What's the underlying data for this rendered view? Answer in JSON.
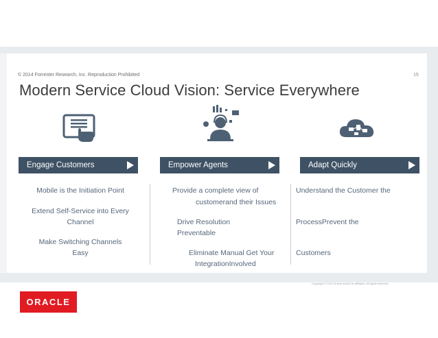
{
  "header": {
    "copyright": "© 2014 Forrester Research, Inc. Reproduction Prohibited",
    "page_number": "15",
    "title": "Modern Service Cloud Vision: Service Everywhere"
  },
  "columns": [
    {
      "heading": "Engage Customers",
      "icon": "tablet-touch-icon",
      "items": [
        "Mobile is the Initiation Point",
        "Extend Self-Service into Every",
        "Channel",
        "Make Switching Channels",
        "Easy"
      ]
    },
    {
      "heading": "Empower Agents",
      "icon": "agent-headset-icon",
      "items": [
        "Provide a complete view of",
        "customerand their Issues",
        "Drive Resolution",
        "Preventable",
        "Eliminate Manual Get Your",
        "IntegrationInvolved"
      ]
    },
    {
      "heading": "Adapt Quickly",
      "icon": "cloud-network-icon",
      "items": [
        "Understand the Customer the",
        "ProcessPrevent the",
        "Customers"
      ]
    }
  ],
  "footer": {
    "copyright": "Copyright © 2014 Oracle and/or its affiliates. All rights reserved.",
    "logo_text": "ORACLE"
  },
  "colors": {
    "bar": "#3f5265",
    "item_text": "#55667a",
    "icon": "#4e6174",
    "logo": "#e11b22"
  }
}
